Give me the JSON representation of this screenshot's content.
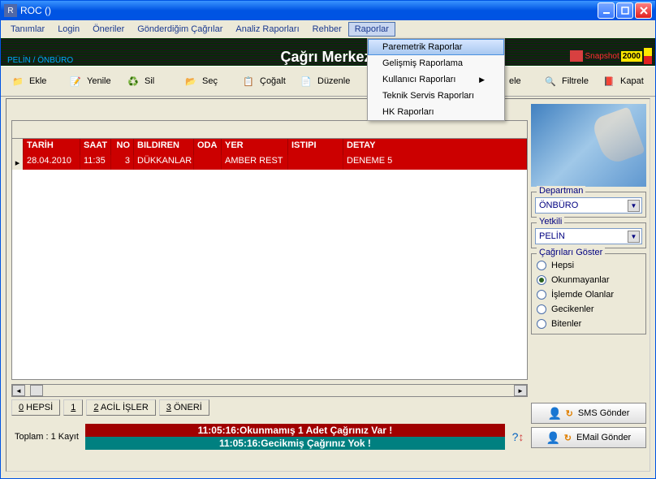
{
  "title": "ROC ()",
  "menubar": [
    "Tanımlar",
    "Login",
    "Öneriler",
    "Gönderdiğim Çağrılar",
    "Analiz Raporları",
    "Rehber",
    "Raporlar"
  ],
  "dropdown": {
    "items": [
      {
        "label": "Paremetrik Raporlar",
        "sub": false
      },
      {
        "label": "Gelişmiş Raporlama",
        "sub": false
      },
      {
        "label": "Kullanıcı Raporları",
        "sub": true
      },
      {
        "label": "Teknik Servis Raporları",
        "sub": false
      },
      {
        "label": "HK Raporları",
        "sub": false
      }
    ],
    "highlighted_index": 0
  },
  "banner": {
    "label": "PELİN / ÖNBÜRO",
    "title": "Çağrı Merkezi",
    "snapshot": "Snapshot",
    "year": "2000"
  },
  "toolbar": [
    "Ekle",
    "Yenile",
    "Sil",
    "Seç",
    "Çoğalt",
    "Düzenle",
    "",
    "ele",
    "Filtrele",
    "Kapat"
  ],
  "grid": {
    "headers": [
      "TARİH",
      "SAAT",
      "NO",
      "BILDIREN",
      "ODA",
      "YER",
      "ISTIPI",
      "DETAY"
    ],
    "rows": [
      {
        "tarih": "28.04.2010",
        "saat": "11:35",
        "no": "3",
        "bildiren": "DÜKKANLAR",
        "oda": "",
        "yer": "AMBER REST",
        "istipi": "",
        "detay": "DENEME 5"
      }
    ]
  },
  "filter_tabs": [
    {
      "u": "0",
      "rest": " HEPSİ"
    },
    {
      "u": "1",
      "rest": ""
    },
    {
      "u": "2",
      "rest": " ACİL İŞLER"
    },
    {
      "u": "3",
      "rest": " ÖNERİ"
    }
  ],
  "status": {
    "total": "Toplam : 1 Kayıt",
    "unread": "11:05:16:Okunmamış 1 Adet Çağrınız Var !",
    "late": "11:05:16:Gecikmiş Çağrınız Yok !"
  },
  "right": {
    "departman": {
      "label": "Departman",
      "value": "ÖNBÜRO"
    },
    "yetkili": {
      "label": "Yetkili",
      "value": "PELİN"
    },
    "goster": {
      "label": "Çağrıları Göster",
      "options": [
        "Hepsi",
        "Okunmayanlar",
        "İşlemde Olanlar",
        "Gecikenler",
        "Bitenler"
      ],
      "selected_index": 1
    },
    "sms": "SMS Gönder",
    "email": "EMail Gönder"
  }
}
